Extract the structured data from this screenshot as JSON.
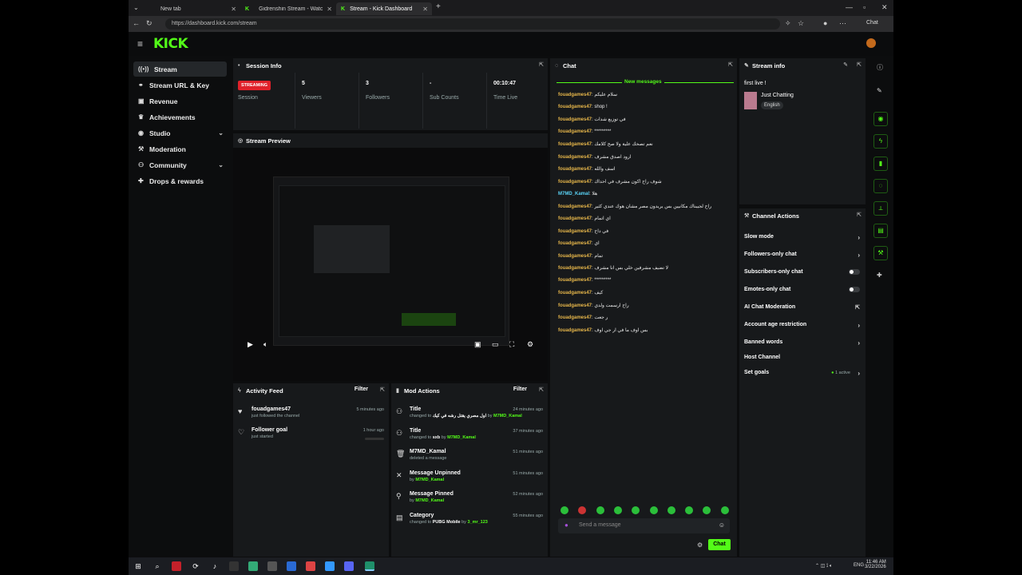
{
  "browser": {
    "tabs": [
      {
        "label": "New tab"
      },
      {
        "label": "Gidrenshin Stream - Watch Li"
      },
      {
        "label": "Stream - Kick Dashboard"
      }
    ],
    "url": "https://dashboard.kick.com/stream",
    "chat_button": "Chat"
  },
  "app": {
    "logo": "KICK"
  },
  "sidebar": {
    "items": [
      {
        "label": "Stream",
        "icon": "broadcast-icon"
      },
      {
        "label": "Stream URL & Key",
        "icon": "link-icon"
      },
      {
        "label": "Revenue",
        "icon": "money-icon"
      },
      {
        "label": "Achievements",
        "icon": "trophy-icon"
      },
      {
        "label": "Studio",
        "icon": "camera-icon"
      },
      {
        "label": "Moderation",
        "icon": "hammer-icon"
      },
      {
        "label": "Community",
        "icon": "users-icon"
      },
      {
        "label": "Drops & rewards",
        "icon": "gift-icon"
      }
    ]
  },
  "session": {
    "title": "Session Info",
    "badge": "STREAMING",
    "stats": [
      {
        "value": "",
        "label": "Session"
      },
      {
        "value": "5",
        "label": "Viewers"
      },
      {
        "value": "3",
        "label": "Followers"
      },
      {
        "value": "-",
        "label": "Sub Counts"
      },
      {
        "value": "00:10:47",
        "label": "Time Live"
      }
    ]
  },
  "preview": {
    "title": "Stream Preview"
  },
  "activity": {
    "title": "Activity Feed",
    "filter": "Filter",
    "items": [
      {
        "title": "fouadgames47",
        "sub": "just followed the channel",
        "time": "5 minutes ago"
      },
      {
        "title": "Follower goal",
        "sub": "just started",
        "time": "1 hour ago"
      }
    ]
  },
  "mod": {
    "title": "Mod Actions",
    "filter": "Filter",
    "items": [
      {
        "title": "Title",
        "pre": "changed to",
        "val": "اول مصري يقتل رشه في كيك",
        "by": "by",
        "user": "M7MD_Kamal",
        "time": "24 minutes ago"
      },
      {
        "title": "Title",
        "pre": "changed to",
        "val": "sxb",
        "by": "by",
        "user": "M7MD_Kamal",
        "time": "37 minutes ago"
      },
      {
        "title": "M7MD_Kamal",
        "pre": "deleted a message",
        "val": "",
        "by": "",
        "user": "",
        "time": "51 minutes ago"
      },
      {
        "title": "Message Unpinned",
        "pre": "",
        "val": "",
        "by": "by",
        "user": "M7MD_Kamal",
        "time": "51 minutes ago"
      },
      {
        "title": "Message Pinned",
        "pre": "",
        "val": "",
        "by": "by",
        "user": "M7MD_Kamal",
        "time": "52 minutes ago"
      },
      {
        "title": "Category",
        "pre": "changed to",
        "val": "PUBG Mobile",
        "by": "by",
        "user": "3_mr_123",
        "time": "55 minutes ago"
      }
    ]
  },
  "chat": {
    "title": "Chat",
    "new_messages": "New messages",
    "messages": [
      {
        "user": "fouadgames47",
        "text": "سلام عليكم"
      },
      {
        "user": "fouadgames47",
        "text": "! shop"
      },
      {
        "user": "fouadgames47",
        "text": "في توزيع شدات"
      },
      {
        "user": "fouadgames47",
        "text": "*********"
      },
      {
        "user": "fouadgames47",
        "text": "نعم تصحك علية ولا صح كلامك"
      },
      {
        "user": "fouadgames47",
        "text": "ارود اصدق مشرف"
      },
      {
        "user": "fouadgames47",
        "text": "اسف والله"
      },
      {
        "user": "fouadgames47",
        "text": "شوف راح اكون مشرف في احداك"
      },
      {
        "user": "M7MD_Kamal",
        "text": "هلا"
      },
      {
        "user": "fouadgames47",
        "text": "راح لجيبناك مكانيين بس يريدون مصر مشان هوك عندي كثير"
      },
      {
        "user": "fouadgames47",
        "text": "اي اتمام"
      },
      {
        "user": "fouadgames47",
        "text": "في داح"
      },
      {
        "user": "fouadgames47",
        "text": "اي"
      },
      {
        "user": "fouadgames47",
        "text": "تمام"
      },
      {
        "user": "fouadgames47",
        "text": "لا تضيف مشرفين خلي بس انا مشرف"
      },
      {
        "user": "fouadgames47",
        "text": "*********"
      },
      {
        "user": "fouadgames47",
        "text": "كيف"
      },
      {
        "user": "fouadgames47",
        "text": "راح ارسمت ولدي"
      },
      {
        "user": "fouadgames47",
        "text": "ر جعت"
      },
      {
        "user": "fouadgames47",
        "text": "بس اوف ما في ار جي اوف"
      }
    ],
    "placeholder": "Send a message",
    "send": "Chat"
  },
  "stream_info": {
    "title": "Stream info",
    "stream_title": "first live !",
    "category": "Just Chatting",
    "language": "English"
  },
  "channel_actions": {
    "title": "Channel Actions",
    "items": [
      {
        "label": "Slow mode",
        "control": "chevron"
      },
      {
        "label": "Followers-only chat",
        "control": "chevron"
      },
      {
        "label": "Subscribers-only chat",
        "control": "toggle"
      },
      {
        "label": "Emotes-only chat",
        "control": "toggle"
      },
      {
        "label": "AI Chat Moderation",
        "control": "external"
      },
      {
        "label": "Account age restriction",
        "control": "chevron"
      },
      {
        "label": "Banned words",
        "control": "chevron"
      },
      {
        "label": "Host Channel",
        "control": "none"
      },
      {
        "label": "Set goals",
        "control": "chevron",
        "status": "1 active"
      }
    ]
  },
  "taskbar": {
    "time": "11:46 AM",
    "date": "3/22/2026",
    "lang": "ENG"
  }
}
